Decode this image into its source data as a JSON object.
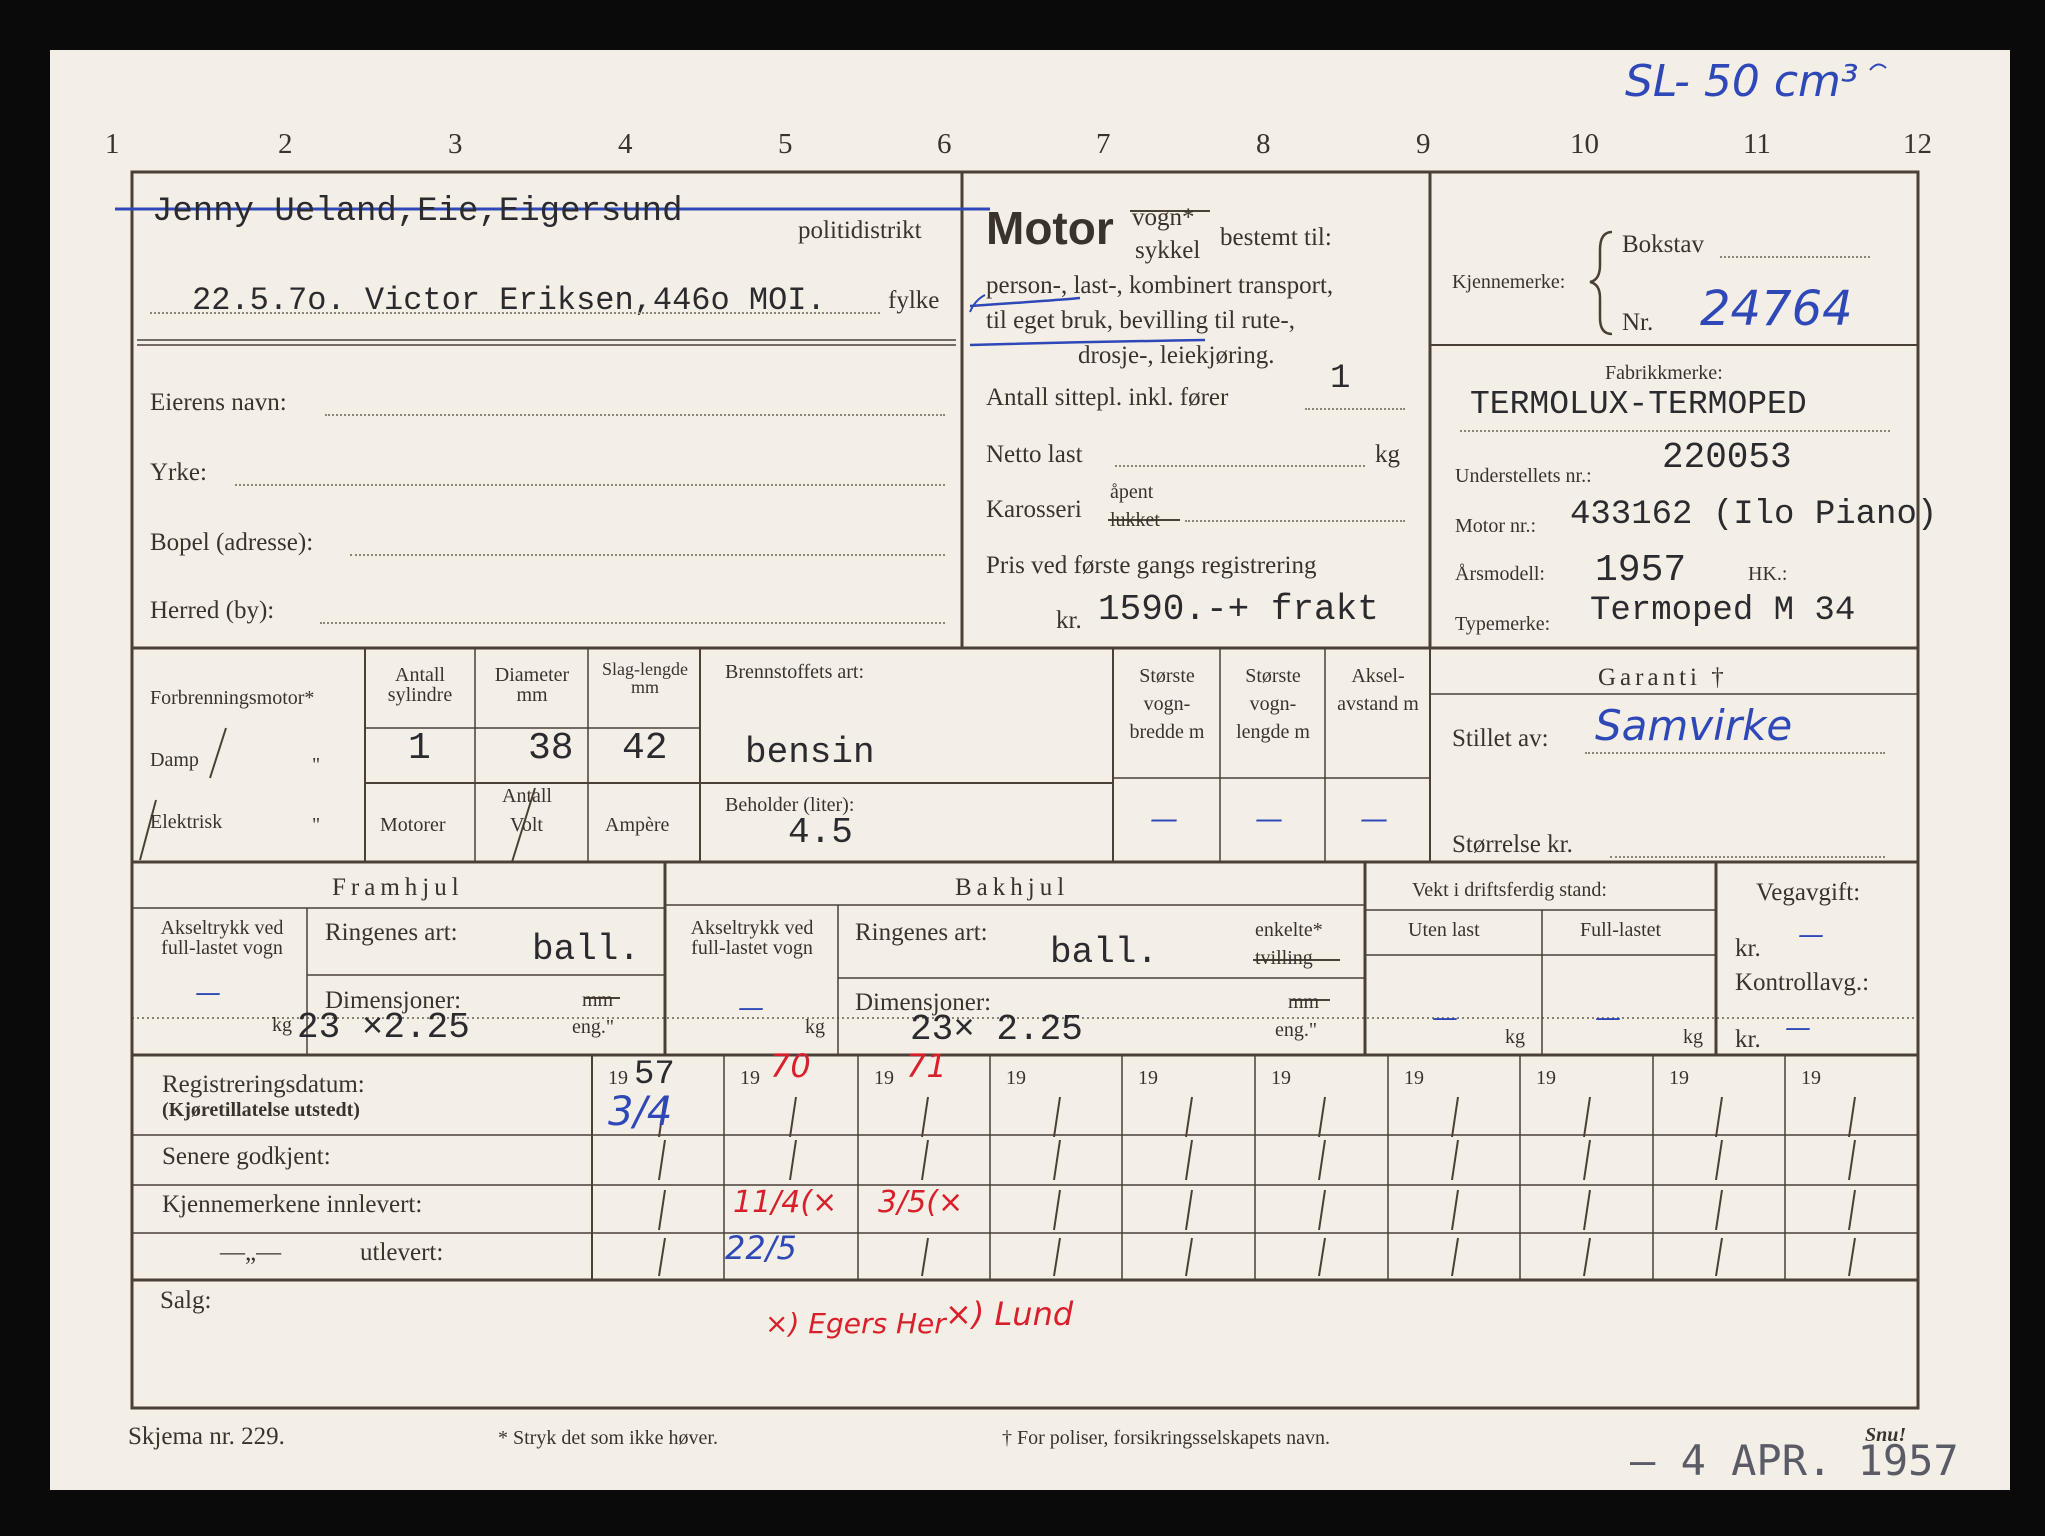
{
  "colors": {
    "paper": "#f3efe6",
    "ink": "#3a332c",
    "ballpoint": "#2f48b8",
    "red": "#d8202c",
    "typewriter": "#2b2a2e",
    "stamp": "#5b5b67"
  },
  "top_note": "SL- 50 cm³",
  "ruler": [
    "1",
    "2",
    "3",
    "4",
    "5",
    "6",
    "7",
    "8",
    "9",
    "10",
    "11",
    "12"
  ],
  "owner": {
    "politidistrikt_label": "politidistrikt",
    "politidistrikt_value": "Jenny Ueland,Eie,Eigersund",
    "fylke_label": "fylke",
    "fylke_value": "22.5.7o. Victor Eriksen,446o MOI.",
    "eierens_navn": "Eierens navn:",
    "yrke": "Yrke:",
    "bopel": "Bopel (adresse):",
    "herred": "Herred (by):"
  },
  "motor": {
    "title": "Motor",
    "vogn": "vogn*",
    "sykkel": "sykkel",
    "bestemt": "bestemt til:",
    "use_line1": "person-, last-, kombinert transport,",
    "use_line2": "til eget bruk, bevilling til rute-,",
    "use_line3": "drosje-, leiekjøring.",
    "sittepl_label": "Antall sittepl. inkl. fører",
    "sittepl_value": "1",
    "netto_label": "Netto last",
    "netto_unit": "kg",
    "karosseri_label": "Karosseri",
    "apent": "åpent",
    "lukket": "lukket",
    "pris_label": "Pris ved første gangs registrering",
    "kr": "kr.",
    "pris_value": "1590.-+ frakt"
  },
  "ident": {
    "kjennemerke_label": "Kjennemerke:",
    "bokstav_label": "Bokstav",
    "nr_label": "Nr.",
    "nr_value": "24764",
    "fabrikkmerke_label": "Fabrikkmerke:",
    "fabrikkmerke_value": "TERMOLUX-TERMOPED",
    "understell_label": "Understellets nr.:",
    "understell_value": "220053",
    "motornr_label": "Motor nr.:",
    "motornr_value": "433162 (Ilo Piano)",
    "arsmodell_label": "Årsmodell:",
    "arsmodell_value": "1957",
    "hk_label": "HK.:",
    "typemerke_label": "Typemerke:",
    "typemerke_value": "Termoped M 34"
  },
  "engine": {
    "forbrenning": "Forbrenningsmotor*",
    "damp": "Damp",
    "elektrisk": "Elektrisk",
    "quote": "\"",
    "antall_syl_h": "Antall sylindre",
    "diameter_h": "Diameter mm",
    "slag_h": "Slag-lengde mm",
    "sylindre": "1",
    "diameter": "38",
    "slag": "42",
    "antall": "Antall",
    "motorer": "Motorer",
    "volt": "Volt",
    "ampere": "Ampère",
    "brennstoff_label": "Brennstoffets art:",
    "brennstoff_value": "bensin",
    "beholder_label": "Beholder (liter):",
    "beholder_value": "4.5",
    "bredde_h": "Største vogn-bredde m",
    "lengde_h": "Største vogn-lengde m",
    "aksel_h": "Aksel-avstand m",
    "dash": "—",
    "garanti": "Garanti †",
    "stillet_label": "Stillet av:",
    "stillet_value": "Samvirke",
    "storrelse": "Størrelse kr."
  },
  "wheels": {
    "framhjul": "Framhjul",
    "bakhjul": "Bakhjul",
    "akseltrykk": "Akseltrykk ved full-lastet vogn",
    "ringenes": "Ringenes art:",
    "front_ring": "ball.",
    "rear_ring": "ball.",
    "dimensjoner": "Dimensjoner:",
    "front_dim": "23   ×2.25",
    "rear_dim": "23×  2.25",
    "mm": "mm",
    "eng": "eng.\"",
    "kg": "kg",
    "enkelte": "enkelte*",
    "tvilling": "tvilling",
    "vekt": "Vekt i driftsferdig stand:",
    "uten": "Uten last",
    "full": "Full-lastet",
    "vegavgift": "Vegavgift:",
    "kr": "kr.",
    "kontrollavg": "Kontrollavg.:"
  },
  "registration": {
    "regdato": "Registreringsdatum:",
    "kjoretillatelse": "(Kjøretillatelse utstedt)",
    "senere": "Senere godkjent:",
    "innlevert": "Kjennemerkene innlevert:",
    "ditto": "—„—",
    "utlevert": "utlevert:",
    "year_prefix": "19",
    "years": [
      "57",
      "70",
      "71",
      "",
      "",
      "",
      "",
      "",
      "",
      ""
    ],
    "reg_dates": [
      "3/4",
      "",
      "",
      "",
      "",
      "",
      "",
      "",
      "",
      ""
    ],
    "innlevert_vals": [
      "",
      "11/4(×",
      "3/5(×",
      "",
      "",
      "",
      "",
      "",
      "",
      ""
    ],
    "utlevert_vals": [
      "",
      "22/5",
      "",
      "",
      "",
      "",
      "",
      "",
      "",
      ""
    ],
    "salg": "Salg:",
    "salg_note1": "×) Egers Her",
    "salg_note2": "×) Lund"
  },
  "footer": {
    "skjema": "Skjema nr. 229.",
    "stryk": "* Stryk det som ikke høver.",
    "poliser": "† For poliser, forsikringsselskapets navn.",
    "stamp": "– 4 APR. 1957",
    "snu": "Snu!"
  }
}
